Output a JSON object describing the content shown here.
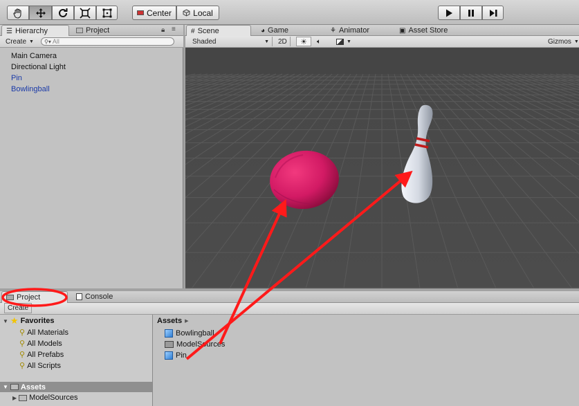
{
  "toolbar": {
    "tools": [
      "hand-tool",
      "move-tool",
      "rotate-tool",
      "scale-tool",
      "rect-tool"
    ],
    "pivot_label": "Center",
    "space_label": "Local"
  },
  "hierarchy": {
    "tab_label": "Hierarchy",
    "other_tab_label": "Project",
    "create_label": "Create",
    "search_placeholder": "All",
    "items": [
      {
        "label": "Main Camera",
        "type": "object"
      },
      {
        "label": "Directional Light",
        "type": "object"
      },
      {
        "label": "Pin",
        "type": "prefab"
      },
      {
        "label": "Bowlingball",
        "type": "prefab"
      }
    ]
  },
  "scene_tabs": {
    "scene": "Scene",
    "game": "Game",
    "animator": "Animator",
    "asset_store": "Asset Store"
  },
  "scene_bar": {
    "shading": "Shaded",
    "mode_2d": "2D",
    "gizmos": "Gizmos"
  },
  "project": {
    "tab_label": "Project",
    "console_tab_label": "Console",
    "create_label": "Create",
    "favorites": {
      "label": "Favorites",
      "items": [
        "All Materials",
        "All Models",
        "All Prefabs",
        "All Scripts"
      ]
    },
    "assets_tree": {
      "label": "Assets",
      "children": [
        "ModelSources"
      ]
    },
    "breadcrumb": "Assets",
    "assets": [
      {
        "label": "Bowlingball",
        "icon": "prefab-icon"
      },
      {
        "label": "ModelSources",
        "icon": "folder-icon"
      },
      {
        "label": "Pin",
        "icon": "prefab-icon"
      }
    ]
  },
  "colors": {
    "annotation_red": "#ff1a1a",
    "ball": "#d81a6a",
    "prefab_text": "#1a3aa8",
    "selection": "#6f6f6f"
  }
}
